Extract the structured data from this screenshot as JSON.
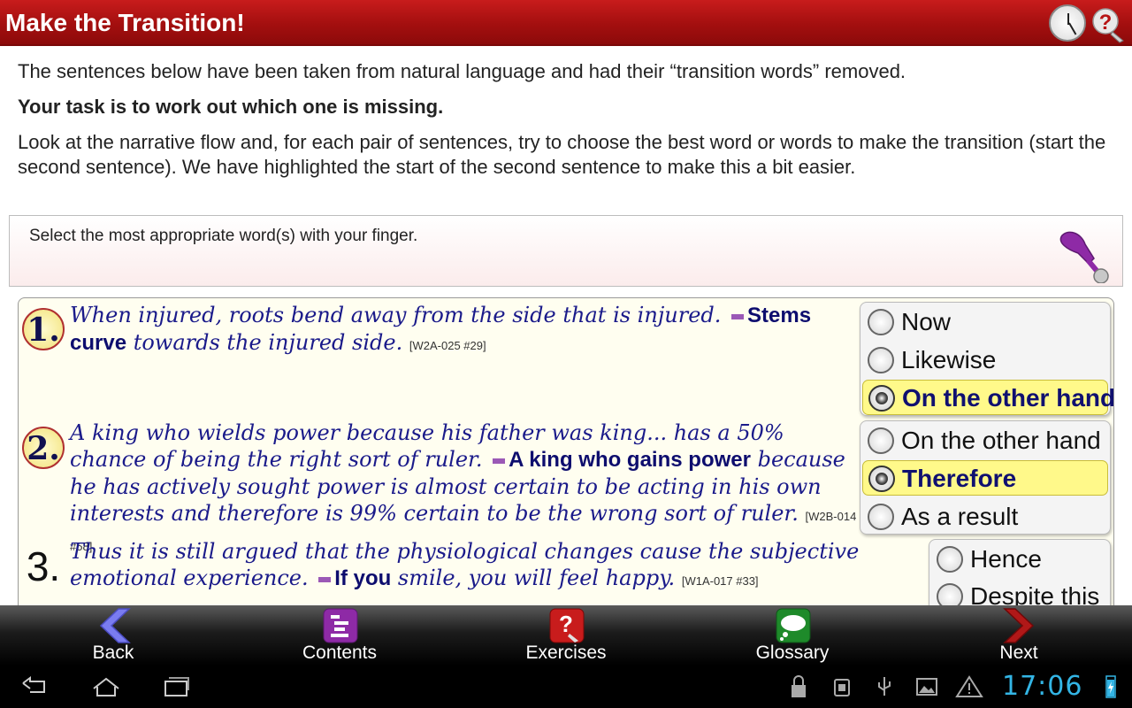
{
  "app": {
    "title": "Make the Transition!",
    "accent": "#b71414",
    "icons": [
      "clock-icon",
      "help-icon"
    ]
  },
  "intro": {
    "line1": "The sentences below have been taken from natural language and had their “transition words” removed.",
    "line2": "Your task is to work out which one is missing.",
    "line3": "Look at the narrative flow and, for each pair of sentences, try to choose the best word or words to make the transition (start the second sentence). We have highlighted the start of the second sentence to make this a bit easier."
  },
  "instruction": {
    "text": "Select the most appropriate word(s) with your finger.",
    "icon": "pointer-icon"
  },
  "questions": [
    {
      "number": "1.",
      "part1": "When injured, roots bend away from the side that is injured.",
      "highlight": "Stems curve",
      "part2": "towards the injured side.",
      "ref": "[W2A-025 #29]",
      "options": [
        "Now",
        "Likewise",
        "On the other hand"
      ],
      "selected": "On the other hand"
    },
    {
      "number": "2.",
      "part1": "A king who wields power because his father was king... has a 50% chance of being the right sort of ruler.",
      "highlight": "A king who gains power",
      "part2": "because he has actively sought power is almost certain to be acting in his own interests and therefore is 99% certain to be the wrong sort of ruler.",
      "ref": "[W2B-014 #58]",
      "options": [
        "On the other hand",
        "Therefore",
        "As a result"
      ],
      "selected": "Therefore"
    },
    {
      "number": "3.",
      "part1": "Thus it is still argued that the physiological changes cause the subjective emotional experience.",
      "highlight": "If you",
      "part2": "smile, you will feel happy.",
      "ref": "[W1A-017 #33]",
      "options": [
        "Hence",
        "Despite this"
      ],
      "selected": ""
    }
  ],
  "nav": {
    "back": "Back",
    "contents": "Contents",
    "exercises": "Exercises",
    "glossary": "Glossary",
    "next": "Next"
  },
  "system": {
    "time": "17:06",
    "clock_color": "#33b5e5"
  }
}
